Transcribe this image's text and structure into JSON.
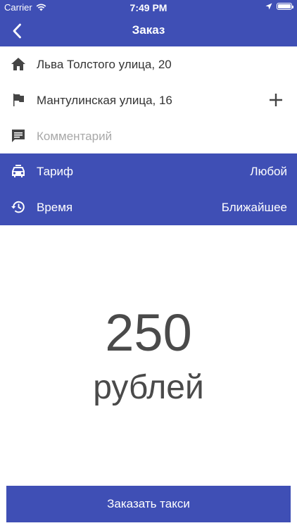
{
  "status_bar": {
    "carrier": "Carrier",
    "time": "7:49 PM",
    "battery_percent": 100
  },
  "nav": {
    "title": "Заказ"
  },
  "route": {
    "from": "Льва Толстого улица, 20",
    "to": "Мантулинская улица, 16",
    "comment_placeholder": "Комментарий"
  },
  "options": {
    "tariff": {
      "label": "Тариф",
      "value": "Любой"
    },
    "time": {
      "label": "Время",
      "value": "Ближайшее"
    }
  },
  "price": {
    "amount": "250",
    "currency": "рублей"
  },
  "order_button": {
    "label": "Заказать такси"
  },
  "colors": {
    "accent": "#3f4fb5",
    "text": "#333333",
    "price_text": "#4a4a4a",
    "placeholder": "#a8a8a8"
  },
  "icons": [
    "chevron-left-icon",
    "home-icon",
    "flag-icon",
    "plus-icon",
    "comment-icon",
    "taxi-icon",
    "history-icon",
    "wifi-icon",
    "location-arrow-icon",
    "battery-icon"
  ]
}
